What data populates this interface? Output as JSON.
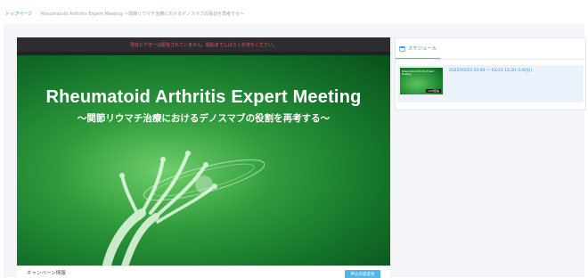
{
  "breadcrumb": {
    "home": "トップページ",
    "separator": "›",
    "current": "Rheumatoid Arthritis Expert Meeting ～関節リウマチ治療におけるデノスマブの役割を再考する～"
  },
  "player": {
    "notice": "現在ビデオ一は配信されていません。開始までしばらくお待ちください。",
    "video_title": "Rheumatoid Arthritis Expert Meeting",
    "video_subtitle": "～関節リウマチ治療におけるデノスマブの役割を再考する～"
  },
  "bottom": {
    "campaign_label": "キャンペーン情報",
    "apply_button": "申込内容変更"
  },
  "schedule": {
    "tab_label": "スケジュール",
    "items": [
      {
        "time": "2022/03/23 10:00 ～ 03/23 12:20 (140分)",
        "thumb_title": "Rheumatoid Arthritis Expert Meeting",
        "badge": "LIVE配信"
      }
    ]
  },
  "colors": {
    "accent": "#4fb6e6",
    "link": "#3a8fd8",
    "notice_text": "#e05a6a",
    "video_green": "#1f8a34"
  }
}
